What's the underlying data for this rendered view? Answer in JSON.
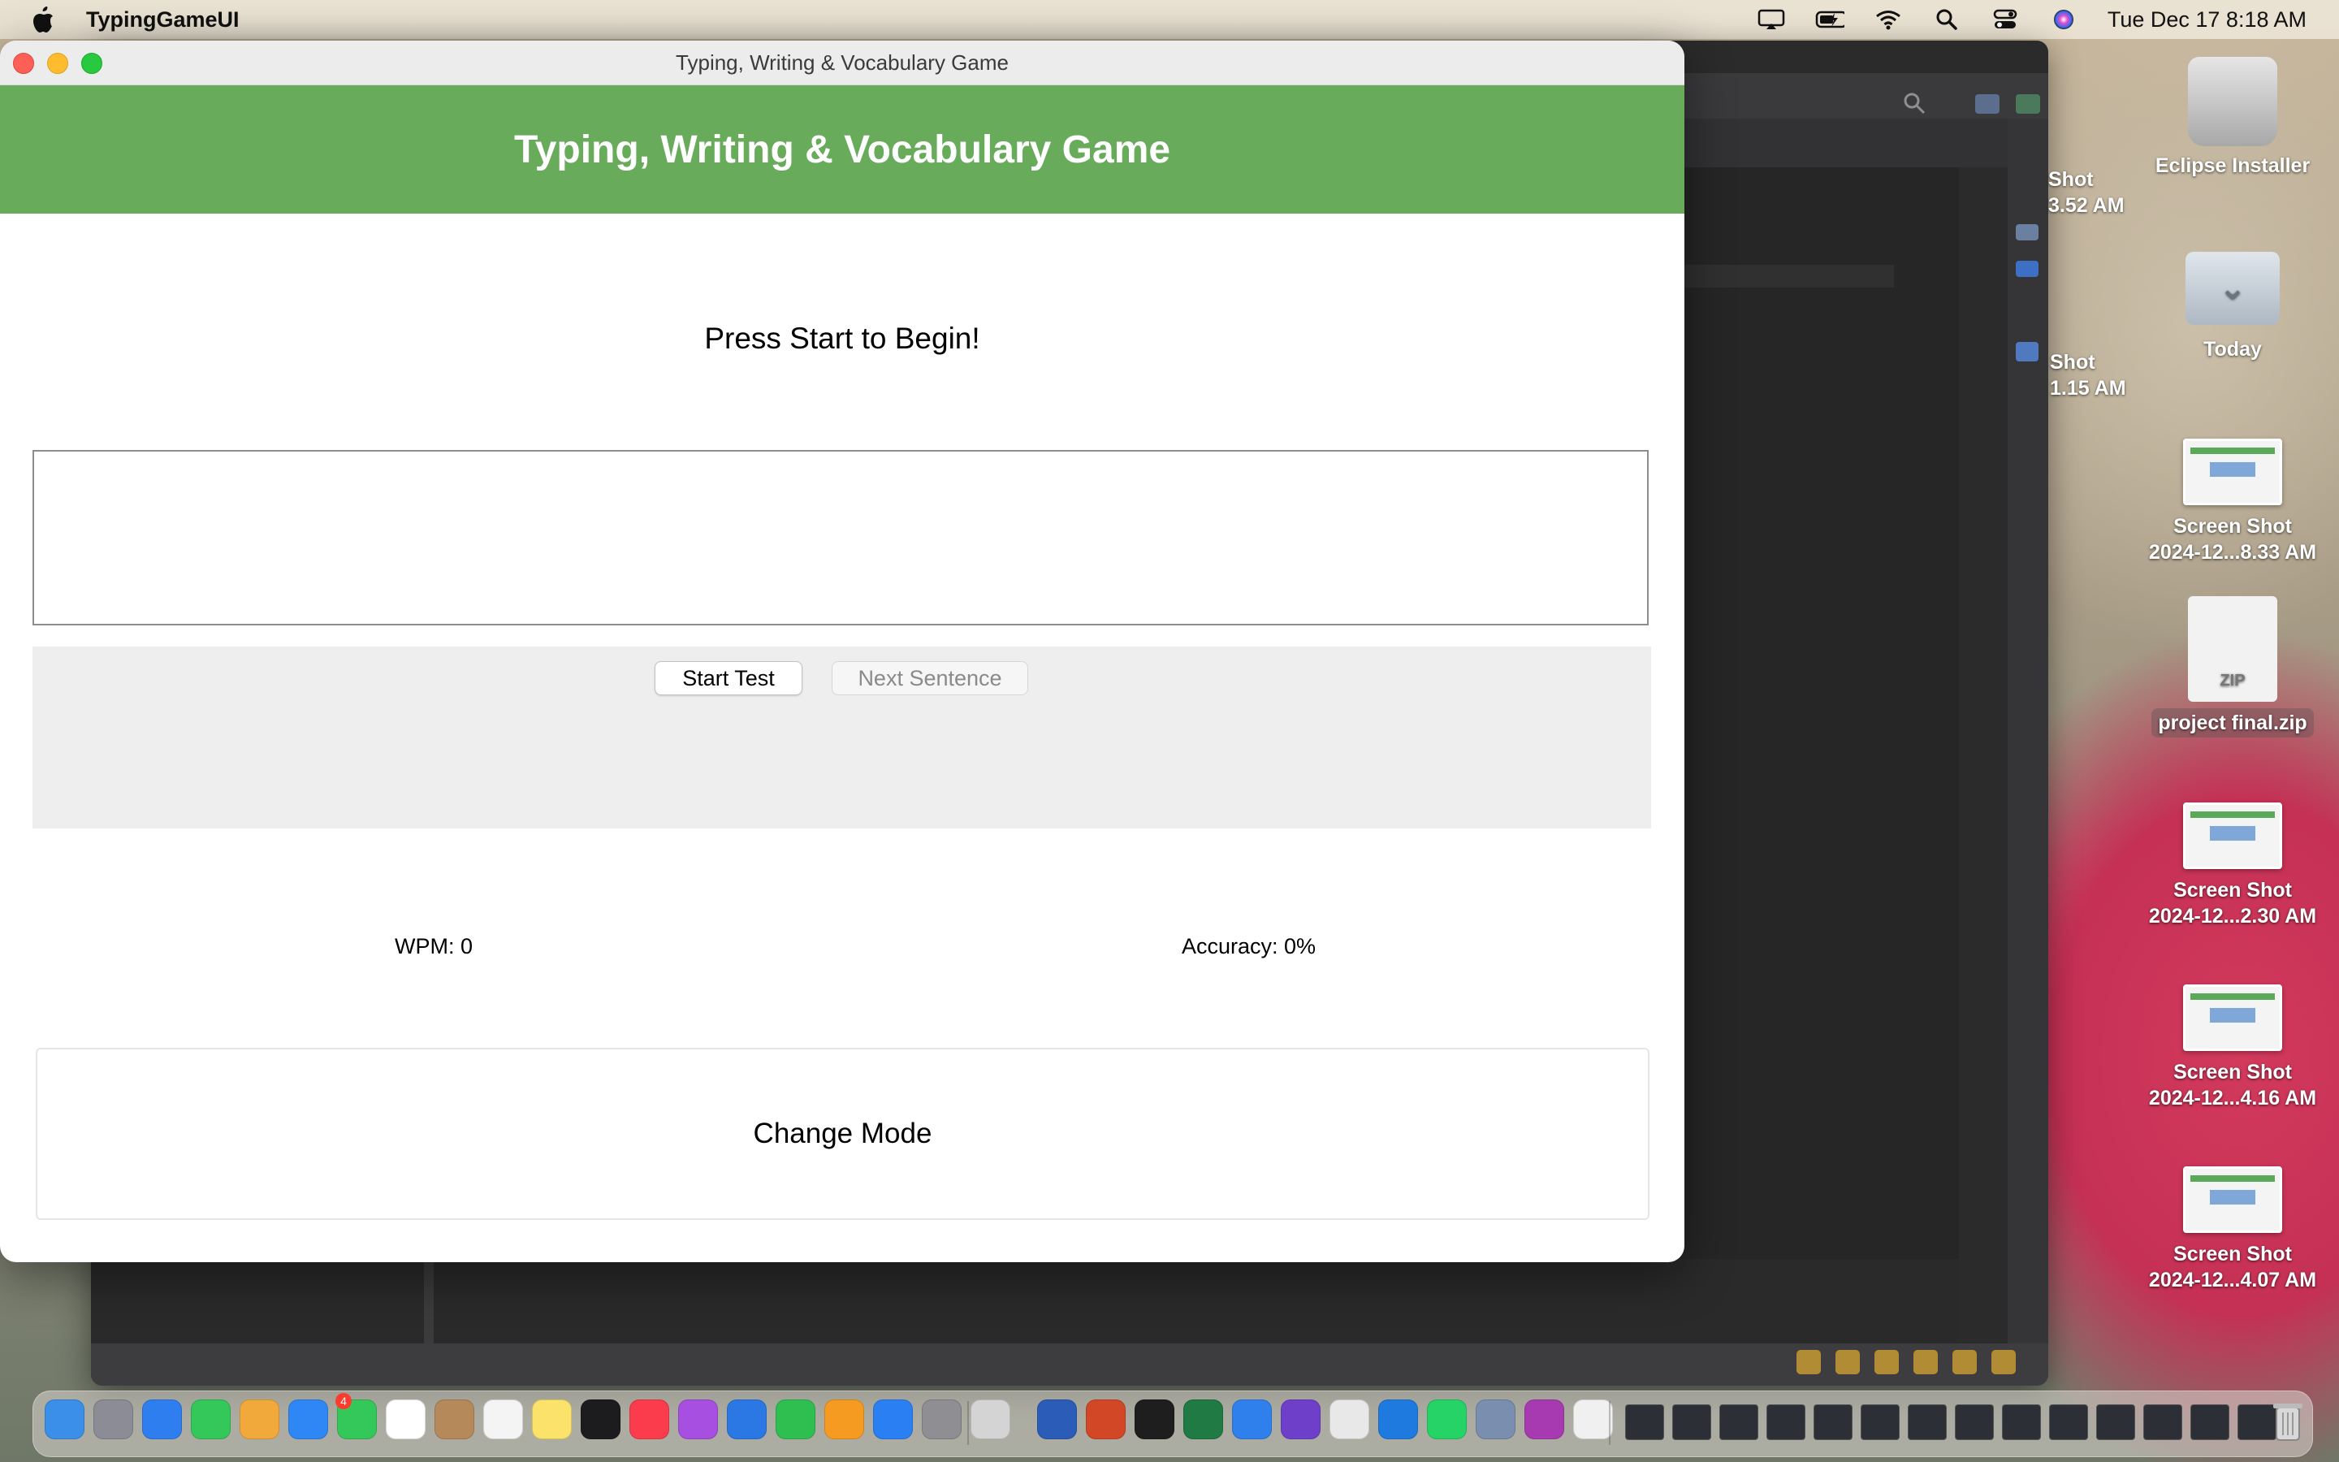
{
  "menubar": {
    "app_name": "TypingGameUI",
    "clock": "Tue Dec 17  8:18 AM"
  },
  "window": {
    "title": "Typing, Writing & Vocabulary Game"
  },
  "game": {
    "banner_title": "Typing, Writing & Vocabulary Game",
    "prompt": "Press Start to Begin!",
    "input_value": "",
    "start_button": "Start Test",
    "next_button": "Next Sentence",
    "wpm": "WPM: 0",
    "accuracy": "Accuracy: 0%",
    "change_mode_button": "Change Mode"
  },
  "desktop": {
    "items": [
      {
        "label": "Eclipse Installer"
      },
      {
        "label": "Today"
      },
      {
        "label_line1": "Screen Shot",
        "label_line2": "2024-12...8.33 AM"
      },
      {
        "label": "project final.zip",
        "icon_text": "ZIP"
      },
      {
        "label_line1": "Screen Shot",
        "label_line2": "2024-12...2.30 AM"
      },
      {
        "label_line1": "Screen Shot",
        "label_line2": "2024-12...4.16 AM"
      },
      {
        "label_line1": "Screen Shot",
        "label_line2": "2024-12...4.07 AM"
      }
    ],
    "partial": [
      {
        "line1": "Shot",
        "line2": "3.52 AM"
      },
      {
        "line1": "Shot",
        "line2": "1.15 AM"
      }
    ]
  },
  "dock": {
    "mail_badge": "4",
    "icon_colors": [
      "#3b8fe8",
      "#8c8c96",
      "#2f7ef0",
      "#34c759",
      "#f2a93b",
      "#2e87f5",
      "#34c759",
      "#ffffff",
      "#b5895a",
      "#f4f4f4",
      "#fbe36b",
      "#1c1c1e",
      "#fa3c4c",
      "#a64fe0",
      "#2b78e4",
      "#2fbf50",
      "#f59b22",
      "#2a7ff2",
      "#8e8e93",
      "#d4d4d4",
      "#2b5cb8",
      "#d24726",
      "#1e1e1e",
      "#1f7a44",
      "#2f80ed",
      "#6e40c9",
      "#e8e8e8",
      "#1f7ae0",
      "#25d366",
      "#7a8eb0",
      "#a73ab0",
      "#f0f0f0"
    ]
  }
}
